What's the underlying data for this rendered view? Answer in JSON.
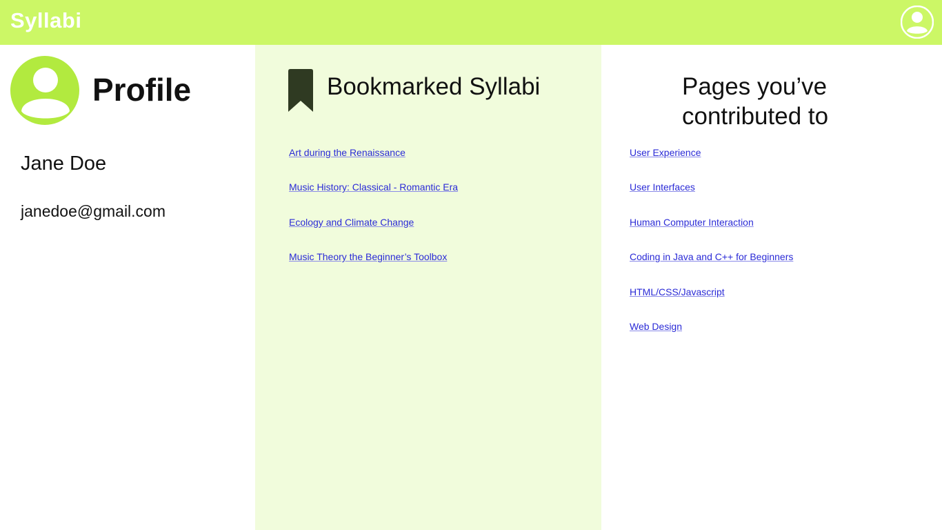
{
  "app": {
    "brand": "Syllabi"
  },
  "colors": {
    "topbar": "#ccf766",
    "avatar": "#b2ea3f",
    "middle_panel": "#f1fcdc",
    "bookmark": "#2f3a22",
    "link": "#2a2ad6"
  },
  "icons": {
    "account": "user-circle-icon",
    "profile": "user-circle-icon",
    "bookmark": "bookmark-icon"
  },
  "profile": {
    "title": "Profile",
    "name": "Jane Doe",
    "email": "janedoe@gmail.com"
  },
  "bookmarked": {
    "title": "Bookmarked Syllabi",
    "items": [
      "Art during the Renaissance",
      "Music History: Classical - Romantic Era",
      "Ecology and Climate Change",
      "Music Theory the Beginner’s Toolbox"
    ]
  },
  "contributed": {
    "title": "Pages you’ve contributed to",
    "items": [
      "User Experience",
      "User Interfaces",
      "Human Computer Interaction",
      "Coding in Java and C++ for Beginners",
      "HTML/CSS/Javascript",
      "Web Design"
    ]
  }
}
